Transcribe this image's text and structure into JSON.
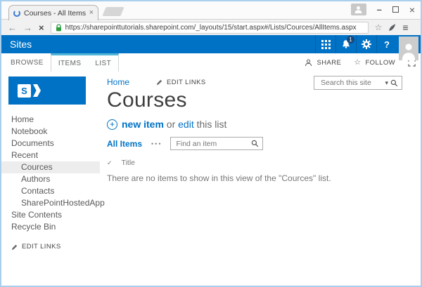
{
  "colors": {
    "accent": "#0072c6",
    "contextual_tab_border": "#52b7d6",
    "notification_badge": "#17487b",
    "lock_green": "#2f9e3f",
    "nav_selected_bg": "#ededed",
    "window_border": "#a9cfec"
  },
  "icons": {
    "spinner": "loading-arc",
    "back": "←",
    "forward": "→",
    "stop": "×",
    "lock": "padlock",
    "bookmark-star": "☆",
    "extension": "leaf-glyph",
    "menu": "≡",
    "minimize": "–",
    "maximize": "box-outline",
    "close": "×",
    "apps": "grid-3x3",
    "bell": "bell-shape",
    "gear": "gear-shape",
    "share": "person-outline",
    "follow-star": "☆",
    "focus": "corner-brackets",
    "pencil": "pencil-shape",
    "plus": "+",
    "search": "magnifier",
    "caret": "▾",
    "ellipsis": "•••",
    "check": "✓"
  },
  "browser": {
    "tab_title": "Courses - All Items",
    "url": "https://sharepointtutorials.sharepoint.com/_layouts/15/start.aspx#/Lists/Cources/AllItems.aspx"
  },
  "suite_bar": {
    "brand": "Sites",
    "notification_count": "1",
    "help_label": "?"
  },
  "ribbon": {
    "tabs": [
      {
        "label": "BROWSE"
      },
      {
        "label": "ITEMS"
      },
      {
        "label": "LIST"
      }
    ],
    "share_label": "SHARE",
    "follow_label": "FOLLOW"
  },
  "sidebar": {
    "items": [
      {
        "label": "Home"
      },
      {
        "label": "Notebook"
      },
      {
        "label": "Documents"
      },
      {
        "label": "Recent"
      },
      {
        "label": "Cources"
      },
      {
        "label": "Authors"
      },
      {
        "label": "Contacts"
      },
      {
        "label": "SharePointHostedApp"
      },
      {
        "label": "Site Contents"
      },
      {
        "label": "Recycle Bin"
      }
    ],
    "edit_links_label": "EDIT LINKS"
  },
  "main": {
    "breadcrumb_home": "Home",
    "edit_links_label": "EDIT LINKS",
    "page_title": "Courses",
    "search_placeholder": "Search this site",
    "new_item_label": "new item",
    "new_item_or": "or",
    "edit_link_label": "edit",
    "this_list_label": "this list",
    "view_label": "All Items",
    "find_placeholder": "Find an item",
    "column_title": "Title",
    "empty_message": "There are no items to show in this view of the \"Cources\" list."
  }
}
